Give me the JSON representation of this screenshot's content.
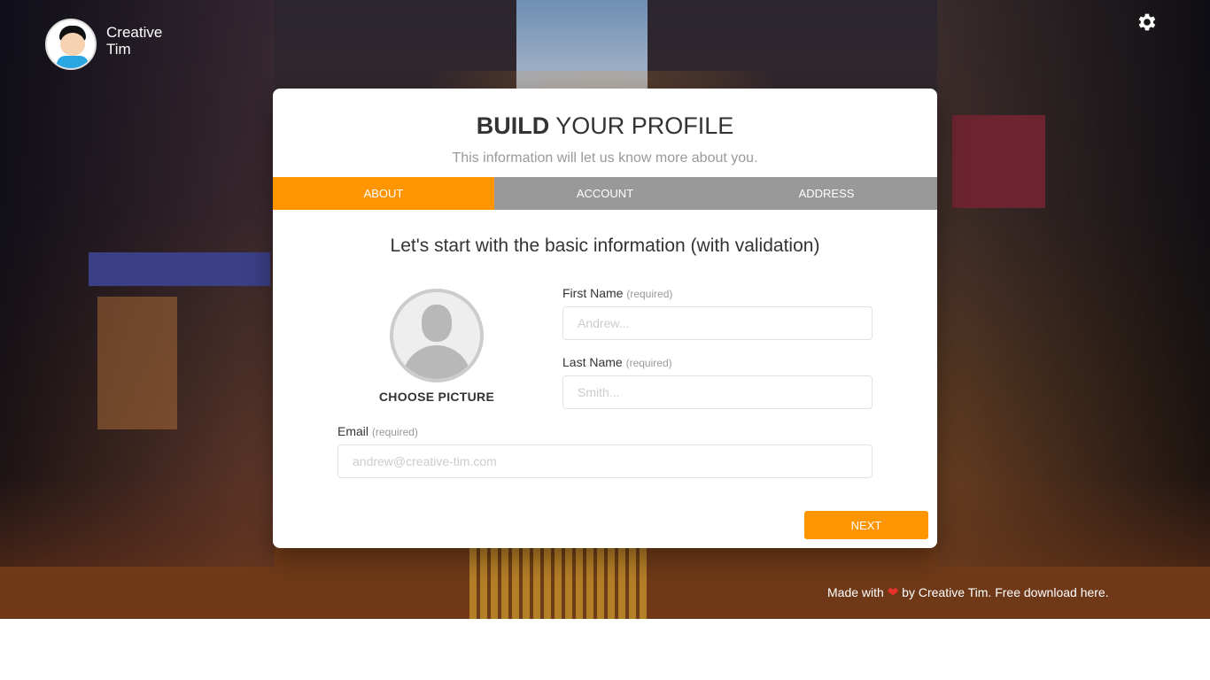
{
  "brand": {
    "name": "Creative Tim",
    "logo_icon": "creative-tim-logo"
  },
  "header": {
    "settings_icon": "gear-icon"
  },
  "wizard": {
    "title_bold": "BUILD",
    "title_rest": " YOUR PROFILE",
    "subtitle": "This information will let us know more about you.",
    "tabs": [
      {
        "label": "ABOUT",
        "active": true
      },
      {
        "label": "ACCOUNT",
        "active": false
      },
      {
        "label": "ADDRESS",
        "active": false
      }
    ],
    "section_title": "Let's start with the basic information (with validation)",
    "picture_label": "CHOOSE PICTURE",
    "fields": {
      "first_name": {
        "label": "First Name",
        "required": "(required)",
        "placeholder": "Andrew...",
        "value": ""
      },
      "last_name": {
        "label": "Last Name",
        "required": "(required)",
        "placeholder": "Smith...",
        "value": ""
      },
      "email": {
        "label": "Email",
        "required": "(required)",
        "placeholder": "andrew@creative-tim.com",
        "value": ""
      }
    },
    "next_label": "NEXT"
  },
  "footer": {
    "made_with": "Made with",
    "by_text": "by Creative Tim. Free download here."
  },
  "colors": {
    "accent": "#ff9500",
    "tab_inactive": "#999999",
    "heart": "#e8322b"
  }
}
